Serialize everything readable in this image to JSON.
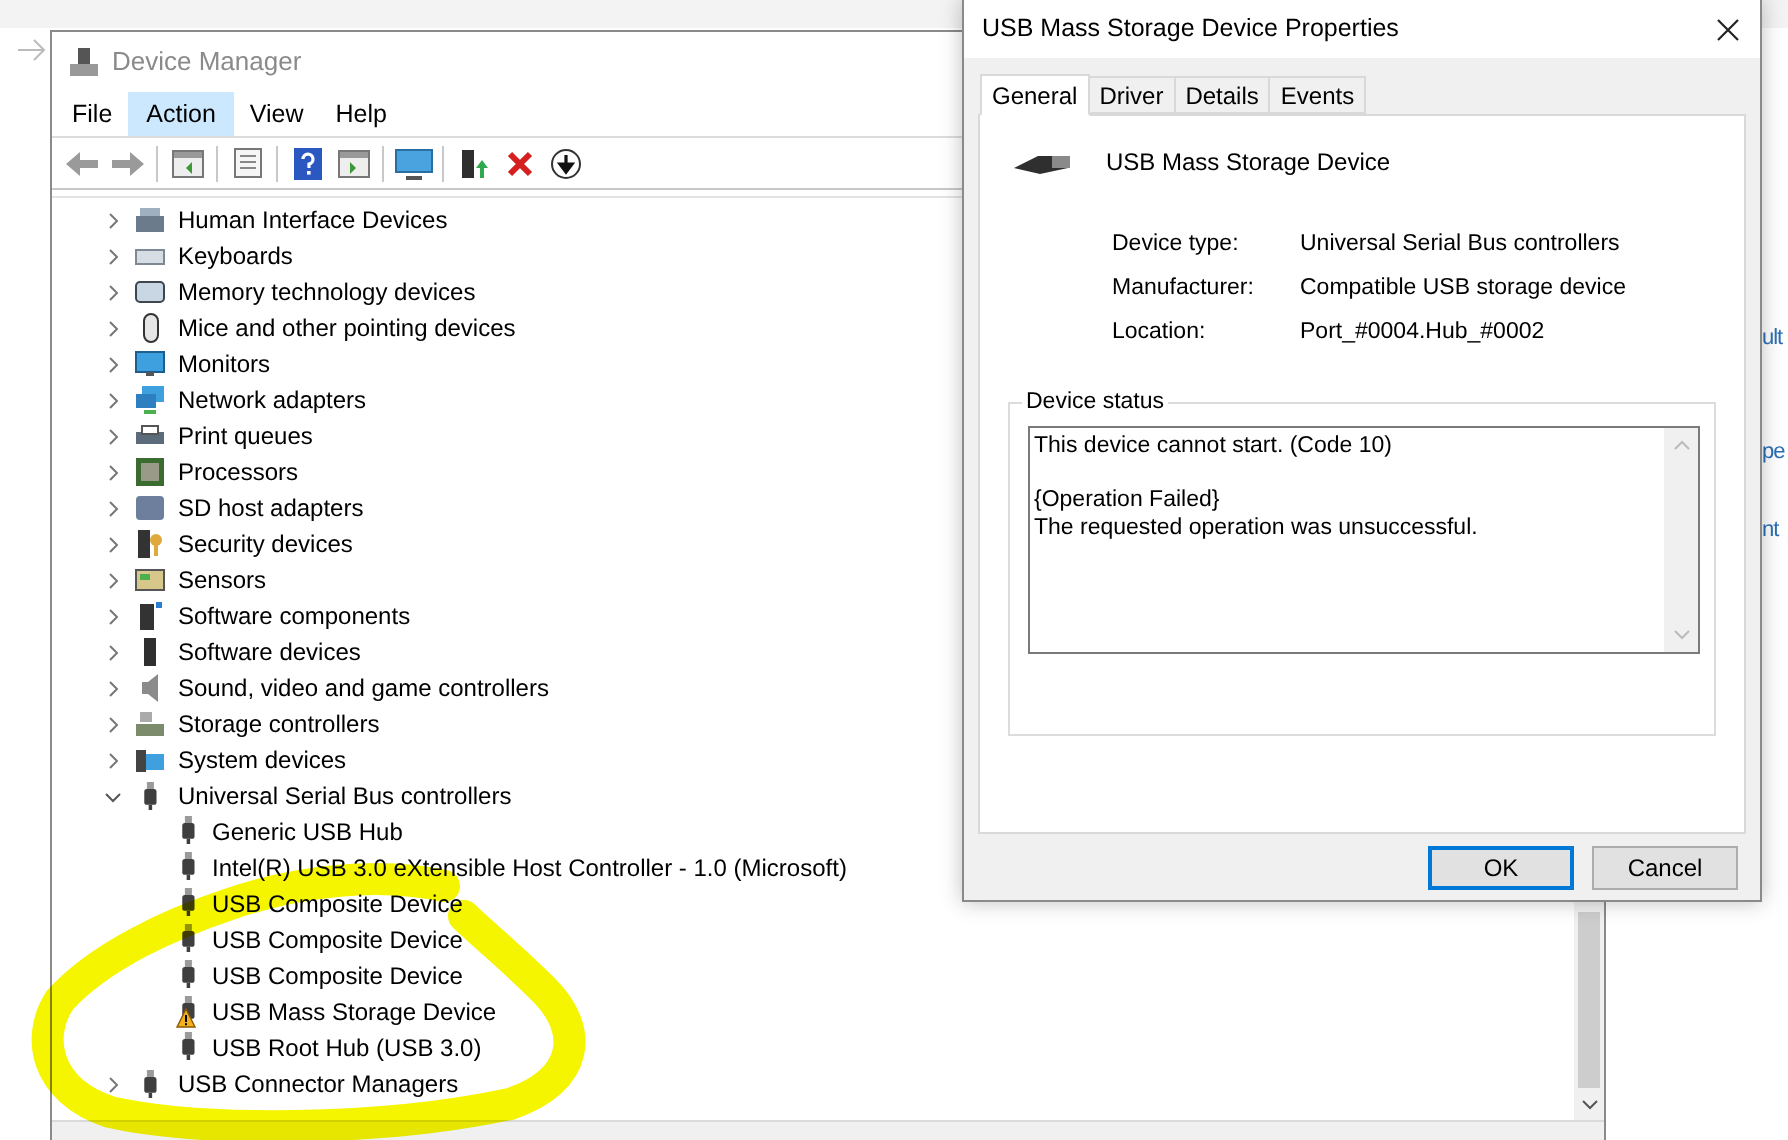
{
  "background": {
    "fragments": [
      "ult",
      "pe",
      "nt"
    ]
  },
  "device_manager": {
    "title": "Device Manager",
    "menu": [
      {
        "label": "File",
        "selected": false
      },
      {
        "label": "Action",
        "selected": true
      },
      {
        "label": "View",
        "selected": false
      },
      {
        "label": "Help",
        "selected": false
      }
    ],
    "tree": [
      {
        "label": "Human Interface Devices",
        "expanded": false
      },
      {
        "label": "Keyboards",
        "expanded": false
      },
      {
        "label": "Memory technology devices",
        "expanded": false
      },
      {
        "label": "Mice and other pointing devices",
        "expanded": false
      },
      {
        "label": "Monitors",
        "expanded": false
      },
      {
        "label": "Network adapters",
        "expanded": false
      },
      {
        "label": "Print queues",
        "expanded": false
      },
      {
        "label": "Processors",
        "expanded": false
      },
      {
        "label": "SD host adapters",
        "expanded": false
      },
      {
        "label": "Security devices",
        "expanded": false
      },
      {
        "label": "Sensors",
        "expanded": false
      },
      {
        "label": "Software components",
        "expanded": false
      },
      {
        "label": "Software devices",
        "expanded": false
      },
      {
        "label": "Sound, video and game controllers",
        "expanded": false
      },
      {
        "label": "Storage controllers",
        "expanded": false
      },
      {
        "label": "System devices",
        "expanded": false
      },
      {
        "label": "Universal Serial Bus controllers",
        "expanded": true,
        "children": [
          {
            "label": "Generic USB Hub",
            "warning": false
          },
          {
            "label": "Intel(R) USB 3.0 eXtensible Host Controller - 1.0 (Microsoft)",
            "warning": false
          },
          {
            "label": "USB Composite Device",
            "warning": false
          },
          {
            "label": "USB Composite Device",
            "warning": false
          },
          {
            "label": "USB Composite Device",
            "warning": false
          },
          {
            "label": "USB Mass Storage Device",
            "warning": true
          },
          {
            "label": "USB Root Hub (USB 3.0)",
            "warning": false
          }
        ]
      },
      {
        "label": "USB Connector Managers",
        "expanded": false
      }
    ]
  },
  "dialog": {
    "title": "USB Mass Storage Device Properties",
    "tabs": [
      {
        "label": "General",
        "selected": true
      },
      {
        "label": "Driver",
        "selected": false
      },
      {
        "label": "Details",
        "selected": false
      },
      {
        "label": "Events",
        "selected": false
      }
    ],
    "device_name": "USB Mass Storage Device",
    "properties": [
      {
        "label": "Device type:",
        "value": "Universal Serial Bus controllers"
      },
      {
        "label": "Manufacturer:",
        "value": "Compatible USB storage device"
      },
      {
        "label": "Location:",
        "value": "Port_#0004.Hub_#0002"
      }
    ],
    "status": {
      "title": "Device status",
      "paragraphs": [
        [
          "This device cannot start. (Code 10)"
        ],
        [
          "{Operation Failed}",
          "The requested operation was unsuccessful."
        ]
      ]
    },
    "buttons": [
      {
        "label": "OK",
        "default": true
      },
      {
        "label": "Cancel",
        "default": false
      }
    ]
  }
}
